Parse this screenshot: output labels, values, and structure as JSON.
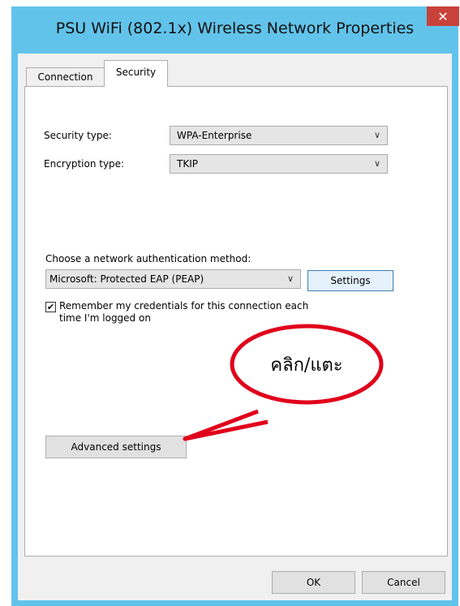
{
  "window": {
    "title": "PSU WiFi (802.1x) Wireless Network Properties",
    "close": "✕"
  },
  "tabs": [
    {
      "label": "Connection"
    },
    {
      "label": "Security"
    }
  ],
  "security": {
    "security_type_label": "Security type:",
    "security_type_value": "WPA-Enterprise",
    "encryption_type_label": "Encryption type:",
    "encryption_type_value": "TKIP",
    "auth_method_label": "Choose a network authentication method:",
    "auth_method_value": "Microsoft: Protected EAP (PEAP)",
    "settings_button": "Settings",
    "remember_checkbox_checked": true,
    "remember_line1": "Remember my credentials for this connection each",
    "remember_line2": "time I'm logged on",
    "advanced_button": "Advanced settings"
  },
  "callout": {
    "text": "คลิก/แตะ"
  },
  "footer": {
    "ok": "OK",
    "cancel": "Cancel"
  },
  "colors": {
    "frame": "#62c3ea",
    "close": "#c8413a",
    "callout": "#e0001b"
  }
}
